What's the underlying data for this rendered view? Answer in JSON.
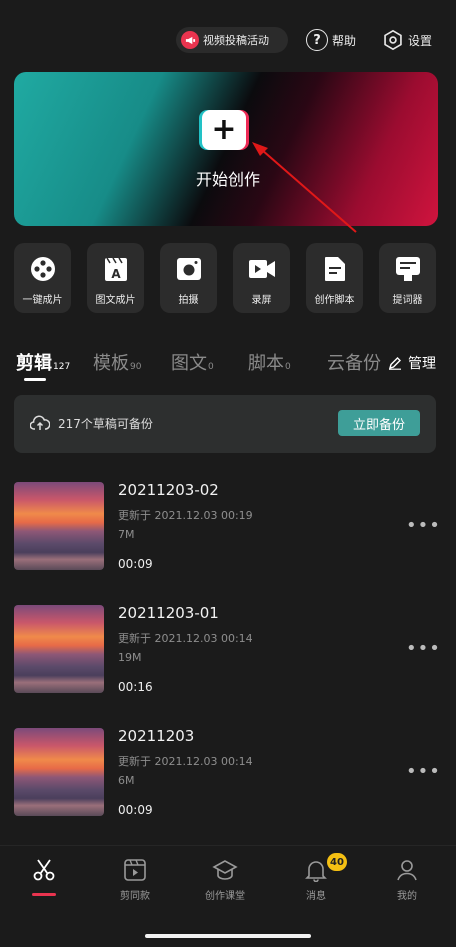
{
  "top_bar": {
    "promo_label": "视频投稿活动",
    "help_label": "帮助",
    "settings_label": "设置"
  },
  "banner": {
    "label": "开始创作"
  },
  "tools": [
    {
      "label": "一键成片",
      "icon": "film-reel-icon"
    },
    {
      "label": "图文成片",
      "icon": "clapper-text-icon"
    },
    {
      "label": "拍摄",
      "icon": "camera-icon"
    },
    {
      "label": "录屏",
      "icon": "video-camera-icon"
    },
    {
      "label": "创作脚本",
      "icon": "script-document-icon"
    },
    {
      "label": "提词器",
      "icon": "teleprompter-icon"
    }
  ],
  "tabs": [
    {
      "label": "剪辑",
      "count": "127",
      "active": true
    },
    {
      "label": "模板",
      "count": "90"
    },
    {
      "label": "图文",
      "count": "0"
    },
    {
      "label": "脚本",
      "count": "0"
    },
    {
      "label": "云备份",
      "count": ""
    }
  ],
  "manage_label": "管理",
  "backup": {
    "text": "217个草稿可备份",
    "button_label": "立即备份"
  },
  "drafts": [
    {
      "title": "20211203-02",
      "updated": "更新于  2021.12.03 00:19",
      "size": "7M",
      "duration": "00:09"
    },
    {
      "title": "20211203-01",
      "updated": "更新于  2021.12.03 00:14",
      "size": "19M",
      "duration": "00:16"
    },
    {
      "title": "20211203",
      "updated": "更新于  2021.12.03 00:14",
      "size": "6M",
      "duration": "00:09"
    }
  ],
  "more_glyph": "•••",
  "bottom_nav": [
    {
      "label": "",
      "icon": "scissors-icon",
      "active": true
    },
    {
      "label": "剪同款",
      "icon": "template-icon"
    },
    {
      "label": "创作课堂",
      "icon": "graduation-cap-icon"
    },
    {
      "label": "消息",
      "icon": "bell-icon",
      "badge": "40"
    },
    {
      "label": "我的",
      "icon": "person-icon"
    }
  ],
  "colors": {
    "accent_red": "#e9344f",
    "teal_button": "#3e9e98",
    "badge_yellow": "#f5c013"
  }
}
